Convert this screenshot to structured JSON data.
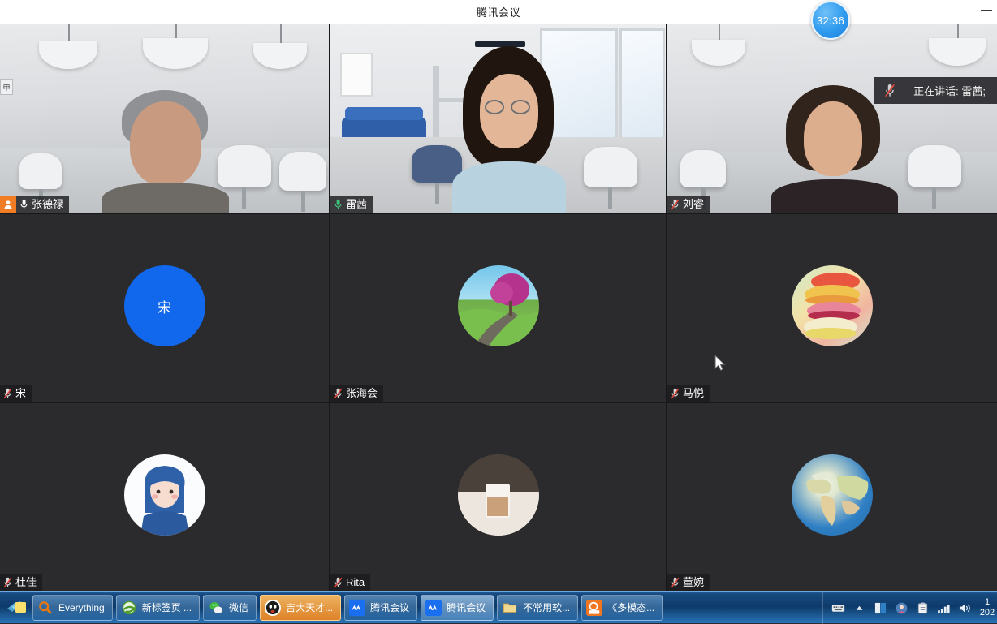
{
  "window": {
    "title": "腾讯会议",
    "minimize_label": "—",
    "edge_stub_label": "申"
  },
  "timer": {
    "value": "32:36"
  },
  "toast": {
    "icon": "mic-muted-icon",
    "text": "正在讲话: 雷茜;"
  },
  "participants": [
    {
      "name": "张德禄",
      "mic": "on",
      "host": true,
      "media": "video",
      "media_kind": "room-a"
    },
    {
      "name": "雷茜",
      "mic": "on",
      "host": false,
      "media": "video",
      "media_kind": "room-b",
      "speaking": true
    },
    {
      "name": "刘睿",
      "mic": "muted",
      "host": false,
      "media": "video",
      "media_kind": "room-a2"
    },
    {
      "name": "宋",
      "mic": "muted",
      "host": false,
      "media": "avatar",
      "avatar": "initial",
      "initial": "宋",
      "avatar_color": "#1168ec"
    },
    {
      "name": "张海会",
      "mic": "muted",
      "host": false,
      "media": "avatar",
      "avatar": "tree"
    },
    {
      "name": "马悦",
      "mic": "muted",
      "host": false,
      "media": "avatar",
      "avatar": "macaron"
    },
    {
      "name": "杜佳",
      "mic": "muted",
      "host": false,
      "media": "avatar",
      "avatar": "girl"
    },
    {
      "name": "Rita",
      "mic": "muted",
      "host": false,
      "media": "avatar",
      "avatar": "coffee"
    },
    {
      "name": "董婉",
      "mic": "muted",
      "host": false,
      "media": "avatar",
      "avatar": "earth"
    }
  ],
  "taskbar": {
    "start_label": "start-button",
    "items": [
      {
        "label": "Everything",
        "icon": "magnifier-icon",
        "state": "normal"
      },
      {
        "label": "新标签页 ...",
        "icon": "browser-icon",
        "state": "normal"
      },
      {
        "label": "微信",
        "icon": "wechat-icon",
        "state": "normal"
      },
      {
        "label": "吉大天才...",
        "icon": "app-icon",
        "state": "active"
      },
      {
        "label": "腾讯会议",
        "icon": "tencent-meeting-icon",
        "state": "normal"
      },
      {
        "label": "腾讯会议",
        "icon": "tencent-meeting-icon",
        "state": "light"
      },
      {
        "label": "不常用软...",
        "icon": "folder-icon",
        "state": "normal"
      },
      {
        "label": "《多模态...",
        "icon": "pdf-icon",
        "state": "normal"
      }
    ],
    "tray": [
      {
        "name": "ime-keyboard-icon"
      },
      {
        "name": "show-hidden-icons-icon"
      },
      {
        "name": "app-tray-icon"
      },
      {
        "name": "user-avatar-tray-icon"
      },
      {
        "name": "clipboard-tray-icon"
      },
      {
        "name": "network-signal-icon"
      },
      {
        "name": "volume-icon"
      }
    ],
    "clock": {
      "time": "1",
      "date": "202"
    }
  }
}
